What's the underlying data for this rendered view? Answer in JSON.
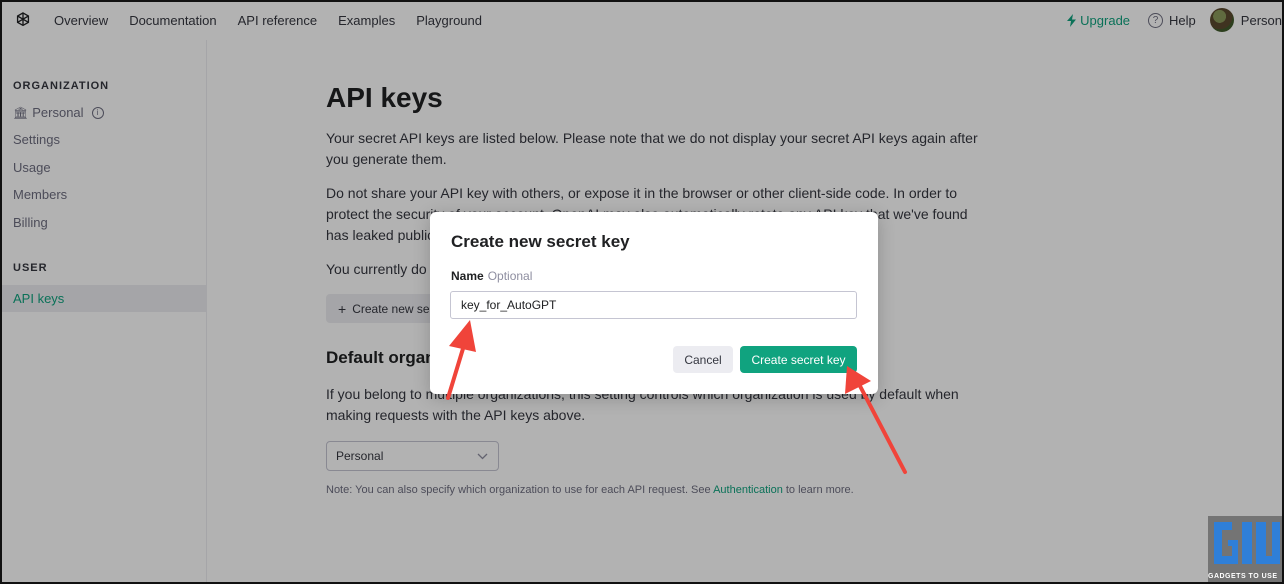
{
  "nav": {
    "links": [
      "Overview",
      "Documentation",
      "API reference",
      "Examples",
      "Playground"
    ],
    "upgrade": "Upgrade",
    "help": "Help",
    "user": "Person"
  },
  "sidebar": {
    "org_heading": "ORGANIZATION",
    "org_name": "Personal",
    "items": [
      "Settings",
      "Usage",
      "Members",
      "Billing"
    ],
    "user_heading": "USER",
    "active_item": "API keys"
  },
  "main": {
    "title": "API keys",
    "para1": "Your secret API keys are listed below. Please note that we do not display your secret API keys again after you generate them.",
    "para2": "Do not share your API key with others, or expose it in the browser or other client-side code. In order to protect the security of your account, OpenAI may also automatically rotate any API key that we've found has leaked publicly.",
    "para3": "You currently do not have any API keys. Please create one below.",
    "create_button": "Create new secret key",
    "default_org_title": "Default organization",
    "default_org_para": "If you belong to multiple organizations, this setting controls which organization is used by default when making requests with the API keys above.",
    "org_select_value": "Personal",
    "note_prefix": "Note: You can also specify which organization to use for each API request. See ",
    "note_link": "Authentication",
    "note_suffix": " to learn more."
  },
  "modal": {
    "title": "Create new secret key",
    "name_label": "Name",
    "optional_label": "Optional",
    "name_value": "key_for_AutoGPT",
    "cancel": "Cancel",
    "submit": "Create secret key"
  },
  "colors": {
    "accent": "#10a37f",
    "arrow": "#f0443a"
  },
  "watermark": "GADGETS TO USE"
}
